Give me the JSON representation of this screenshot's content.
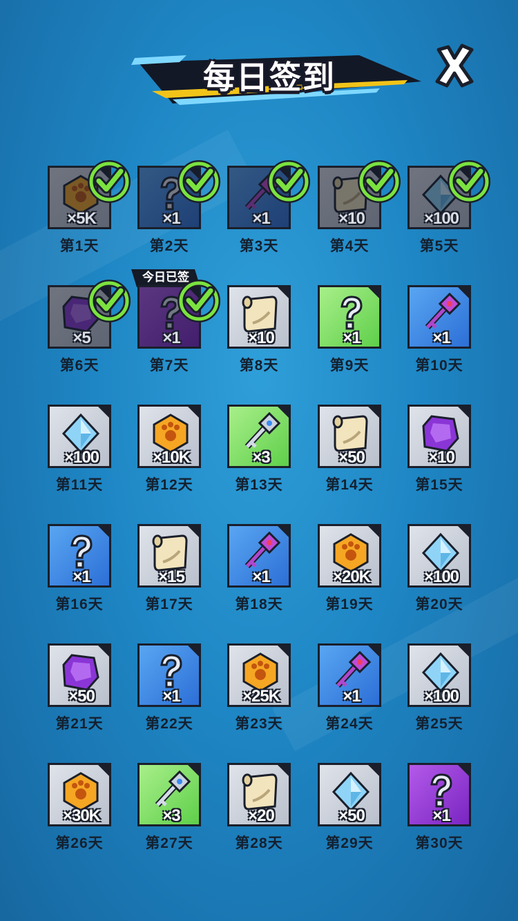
{
  "header": {
    "title": "每日签到"
  },
  "today_badge": "今日已签",
  "days": [
    {
      "label": "第1天",
      "qty": "×5K",
      "item": "coin-icon",
      "bg": "gray",
      "claimed": true
    },
    {
      "label": "第2天",
      "qty": "×1",
      "item": "mystery-icon",
      "bg": "blue",
      "claimed": true
    },
    {
      "label": "第3天",
      "qty": "×1",
      "item": "purple-key-icon",
      "bg": "blue",
      "claimed": true
    },
    {
      "label": "第4天",
      "qty": "×10",
      "item": "scroll-icon",
      "bg": "gray",
      "claimed": true
    },
    {
      "label": "第5天",
      "qty": "×100",
      "item": "diamond-icon",
      "bg": "gray",
      "claimed": true
    },
    {
      "label": "第6天",
      "qty": "×5",
      "item": "gem-icon",
      "bg": "gray",
      "claimed": true
    },
    {
      "label": "第7天",
      "qty": "×1",
      "item": "mystery-icon",
      "bg": "purple",
      "claimed": true
    },
    {
      "label": "第8天",
      "qty": "×10",
      "item": "scroll-icon",
      "bg": "gray",
      "claimed": false
    },
    {
      "label": "第9天",
      "qty": "×1",
      "item": "mystery-icon",
      "bg": "green",
      "claimed": false
    },
    {
      "label": "第10天",
      "qty": "×1",
      "item": "purple-key-icon",
      "bg": "blue",
      "claimed": false
    },
    {
      "label": "第11天",
      "qty": "×100",
      "item": "diamond-icon",
      "bg": "gray",
      "claimed": false
    },
    {
      "label": "第12天",
      "qty": "×10K",
      "item": "coin-icon",
      "bg": "gray",
      "claimed": false
    },
    {
      "label": "第13天",
      "qty": "×3",
      "item": "silver-key-icon",
      "bg": "green",
      "claimed": false
    },
    {
      "label": "第14天",
      "qty": "×50",
      "item": "scroll-icon",
      "bg": "gray",
      "claimed": false
    },
    {
      "label": "第15天",
      "qty": "×10",
      "item": "gem-icon",
      "bg": "gray",
      "claimed": false
    },
    {
      "label": "第16天",
      "qty": "×1",
      "item": "mystery-icon",
      "bg": "blue",
      "claimed": false
    },
    {
      "label": "第17天",
      "qty": "×15",
      "item": "scroll-icon",
      "bg": "gray",
      "claimed": false
    },
    {
      "label": "第18天",
      "qty": "×1",
      "item": "purple-key-icon",
      "bg": "blue",
      "claimed": false
    },
    {
      "label": "第19天",
      "qty": "×20K",
      "item": "coin-icon",
      "bg": "gray",
      "claimed": false
    },
    {
      "label": "第20天",
      "qty": "×100",
      "item": "diamond-icon",
      "bg": "gray",
      "claimed": false
    },
    {
      "label": "第21天",
      "qty": "×50",
      "item": "gem-icon",
      "bg": "gray",
      "claimed": false
    },
    {
      "label": "第22天",
      "qty": "×1",
      "item": "mystery-icon",
      "bg": "blue",
      "claimed": false
    },
    {
      "label": "第23天",
      "qty": "×25K",
      "item": "coin-icon",
      "bg": "gray",
      "claimed": false
    },
    {
      "label": "第24天",
      "qty": "×1",
      "item": "purple-key-icon",
      "bg": "blue",
      "claimed": false
    },
    {
      "label": "第25天",
      "qty": "×100",
      "item": "diamond-icon",
      "bg": "gray",
      "claimed": false
    },
    {
      "label": "第26天",
      "qty": "×30K",
      "item": "coin-icon",
      "bg": "gray",
      "claimed": false
    },
    {
      "label": "第27天",
      "qty": "×3",
      "item": "silver-key-icon",
      "bg": "green",
      "claimed": false
    },
    {
      "label": "第28天",
      "qty": "×20",
      "item": "scroll-icon",
      "bg": "gray",
      "claimed": false
    },
    {
      "label": "第29天",
      "qty": "×50",
      "item": "diamond-icon",
      "bg": "gray",
      "claimed": false
    },
    {
      "label": "第30天",
      "qty": "×1",
      "item": "mystery-icon",
      "bg": "purple",
      "claimed": false
    }
  ],
  "colors": {
    "check": "#7be23f",
    "tile_border": "#1a1f2b",
    "background": "#2489c8"
  }
}
